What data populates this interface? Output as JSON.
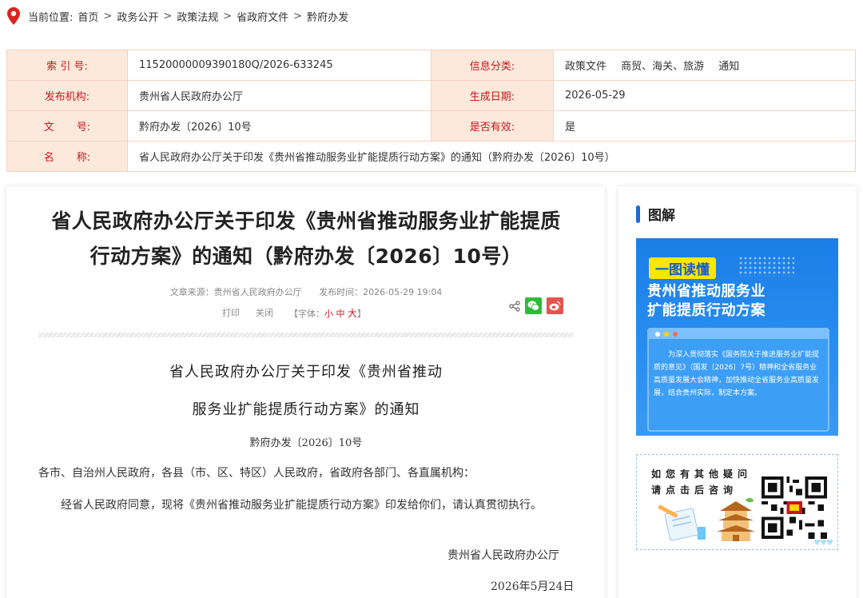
{
  "breadcrumb": {
    "prefix": "当前位置:",
    "items": [
      "首页",
      "政务公开",
      "政策法规",
      "省政府文件",
      "黔府办发"
    ],
    "sep": ">"
  },
  "info": {
    "index_label": "索 引 号:",
    "index_value": "11520000009390180Q/2026-633245",
    "category_label": "信息分类:",
    "category_value": "政策文件 商贸、海关、旅游 通知",
    "publisher_label": "发布机构:",
    "publisher_value": "贵州省人民政府办公厅",
    "date_label": "生成日期:",
    "date_value": "2026-05-29",
    "docno_label": "文 号:",
    "docno_value": "黔府办发〔2026〕10号",
    "valid_label": "是否有效:",
    "valid_value": "是",
    "name_label": "名 称:",
    "name_value": "省人民政府办公厅关于印发《贵州省推动服务业扩能提质行动方案》的通知（黔府办发〔2026〕10号）"
  },
  "article": {
    "title_line1": "省人民政府办公厅关于印发《贵州省推动服务业扩能提质",
    "title_line2": "行动方案》的通知（黔府办发〔2026〕10号）",
    "source": "文章来源：贵州省人民政府办公厅",
    "pubtime": "发布时间：2026-05-29 19:04",
    "print": "打印",
    "close": "关闭",
    "font_prefix": "【字体：",
    "font_small": "小",
    "font_mid": "中",
    "font_big": "大",
    "font_suffix": "】",
    "doc_title_1": "省人民政府办公厅关于印发《贵州省推动",
    "doc_title_2": "服务业扩能提质行动方案》的通知",
    "doc_no": "黔府办发〔2026〕10号",
    "addressee": "各市、自治州人民政府，各县（市、区、特区）人民政府，省政府各部门、各直属机构：",
    "body": "经省人民政府同意，现将《贵州省推动服务业扩能提质行动方案》印发给你们，请认真贯彻执行。",
    "signer": "贵州省人民政府办公厅",
    "sign_date": "2026年5月24日"
  },
  "sidebar": {
    "title": "图解",
    "poster_tag": "一图读懂",
    "poster_line1": "贵州省推动服务业",
    "poster_line2": "扩能提质行动方案",
    "poster_text": "为深入贯彻落实《国务院关于推进服务业扩能提质的意见》（国发〔2026〕7号）精神和全省服务业高质量发展大会精神，加快推动全省服务业高质量发展，结合贵州实际，制定本方案。",
    "consult_line1": "如您有其他疑问",
    "consult_line2": "请点击后咨询"
  },
  "colors": {
    "accent_red": "#c8161d",
    "table_bg": "#fde9dc",
    "blue": "#1d68d8",
    "wechat": "#2dbc3a",
    "weibo": "#e2554d"
  }
}
